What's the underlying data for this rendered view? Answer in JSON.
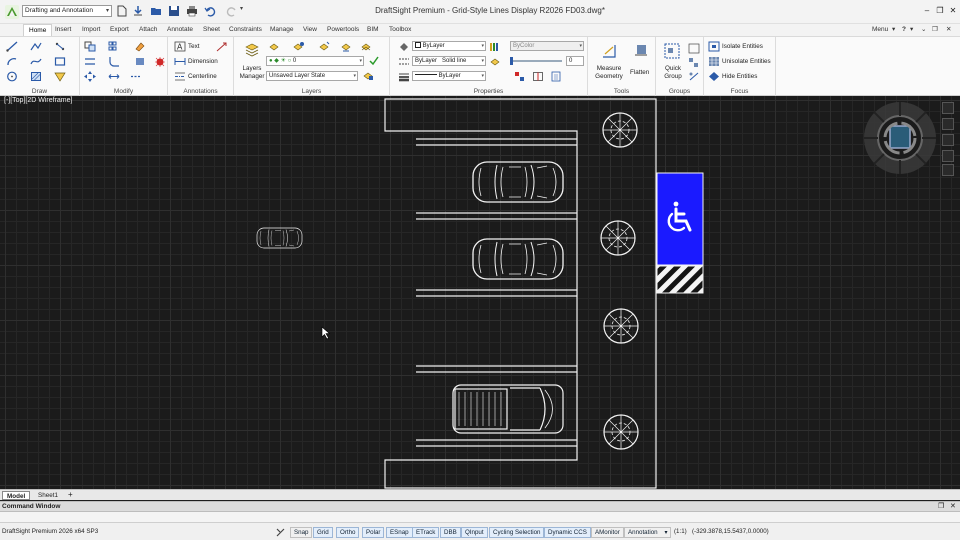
{
  "titlebar": {
    "workspace": "Drafting and Annotation",
    "window_title": "DraftSight Premium - Grid-Style Lines Display R2026 FD03.dwg*"
  },
  "ribbon_tabs": [
    "Home",
    "Insert",
    "Import",
    "Export",
    "Attach",
    "Annotate",
    "Sheet",
    "Constraints",
    "Manage",
    "View",
    "Powertools",
    "BIM",
    "Toolbox"
  ],
  "ribbon_menu": "Menu",
  "panels": {
    "draw": "Draw",
    "modify": "Modify",
    "annotations": "Annotations",
    "layers": "Layers",
    "properties": "Properties",
    "tools": "Tools",
    "groups": "Groups",
    "focus": "Focus"
  },
  "annotations": {
    "text": "Text",
    "dimension": "Dimension",
    "centerline": "Centerline"
  },
  "layers": {
    "manager_label": "Layers Manager",
    "current_layer": "0",
    "layer_state": "Unsaved Layer State"
  },
  "properties": {
    "color": "ByLayer",
    "linestyle_layer": "ByLayer",
    "linestyle": "Solid line",
    "lineweight": "ByLayer",
    "bycolor": "ByColor",
    "transparency": "0"
  },
  "tools": {
    "measure": "Measure Geometry",
    "flatten": "Flatten"
  },
  "groups": {
    "quick_group": "Quick Group"
  },
  "focus": {
    "isolate": "Isolate Entities",
    "unisolate": "Unisolate Entities",
    "hide": "Hide Entities"
  },
  "viewport": {
    "label": "[-][Top][2D Wireframe]",
    "accessible_color": "#1a1aff"
  },
  "layout_tabs": [
    "Model",
    "Sheet1"
  ],
  "command_window": {
    "title": "Command Window"
  },
  "statusbar": {
    "version": "DraftSight Premium 2026  x64 SP3",
    "toggles": [
      "Snap",
      "Grid",
      "Ortho",
      "Polar",
      "ESnap",
      "ETrack",
      "DBB",
      "QInput",
      "Cycling Selection",
      "Dynamic CCS",
      "AMonitor",
      "Annotation"
    ],
    "scale": "(1:1)",
    "coordinates": "(-329.3878,15.5437,0.0000)"
  }
}
